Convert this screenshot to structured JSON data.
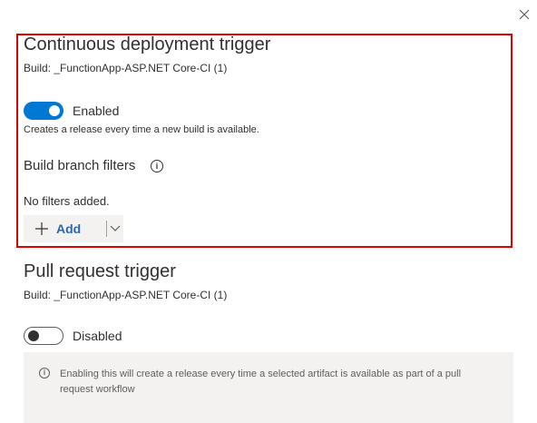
{
  "close_icon": "close-icon",
  "cd_trigger": {
    "title": "Continuous deployment trigger",
    "build": "Build: _FunctionApp-ASP.NET Core-CI (1)",
    "toggle_state": "on",
    "toggle_label": "Enabled",
    "description": "Creates a release every time a new build is available.",
    "filters_heading": "Build branch filters",
    "info_glyph": "i",
    "no_filters": "No filters added.",
    "add_label": "Add"
  },
  "pr_trigger": {
    "title": "Pull request trigger",
    "build": "Build: _FunctionApp-ASP.NET Core-CI (1)",
    "toggle_state": "off",
    "toggle_label": "Disabled",
    "info_glyph": "i",
    "info_text": "Enabling this will create a release every time a selected artifact is available as part of a pull request workflow"
  },
  "colors": {
    "accent": "#0078d4",
    "highlight_border": "#e00000",
    "link_blue": "#2b66b4"
  }
}
